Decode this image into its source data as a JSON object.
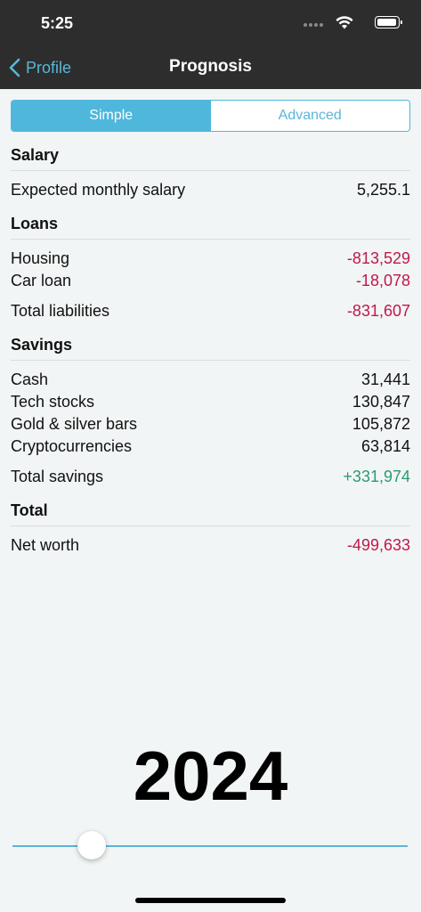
{
  "status_bar": {
    "time": "5:25"
  },
  "nav": {
    "back_label": "Profile",
    "title": "Prognosis"
  },
  "segments": {
    "simple": "Simple",
    "advanced": "Advanced",
    "selected": "Simple"
  },
  "salary": {
    "header": "Salary",
    "expected_label": "Expected monthly salary",
    "expected_value": "5,255.1"
  },
  "loans": {
    "header": "Loans",
    "items": [
      {
        "label": "Housing",
        "value": "-813,529"
      },
      {
        "label": "Car loan",
        "value": "-18,078"
      }
    ],
    "total_label": "Total liabilities",
    "total_value": "-831,607"
  },
  "savings": {
    "header": "Savings",
    "items": [
      {
        "label": "Cash",
        "value": "31,441"
      },
      {
        "label": "Tech stocks",
        "value": "130,847"
      },
      {
        "label": "Gold & silver bars",
        "value": "105,872"
      },
      {
        "label": "Cryptocurrencies",
        "value": "63,814"
      }
    ],
    "total_label": "Total savings",
    "total_value": "+331,974"
  },
  "total": {
    "header": "Total",
    "net_worth_label": "Net worth",
    "net_worth_value": "-499,633"
  },
  "year_slider": {
    "year": "2024",
    "position_fraction": 0.2
  },
  "colors": {
    "accent": "#4fb7dc",
    "negative": "#c0184a",
    "positive": "#2b9a72",
    "nav_background": "#2d2d2d"
  },
  "icons": {
    "back": "chevron-left-icon",
    "wifi": "wifi-icon",
    "battery": "battery-icon",
    "signal": "signal-dots-icon"
  }
}
